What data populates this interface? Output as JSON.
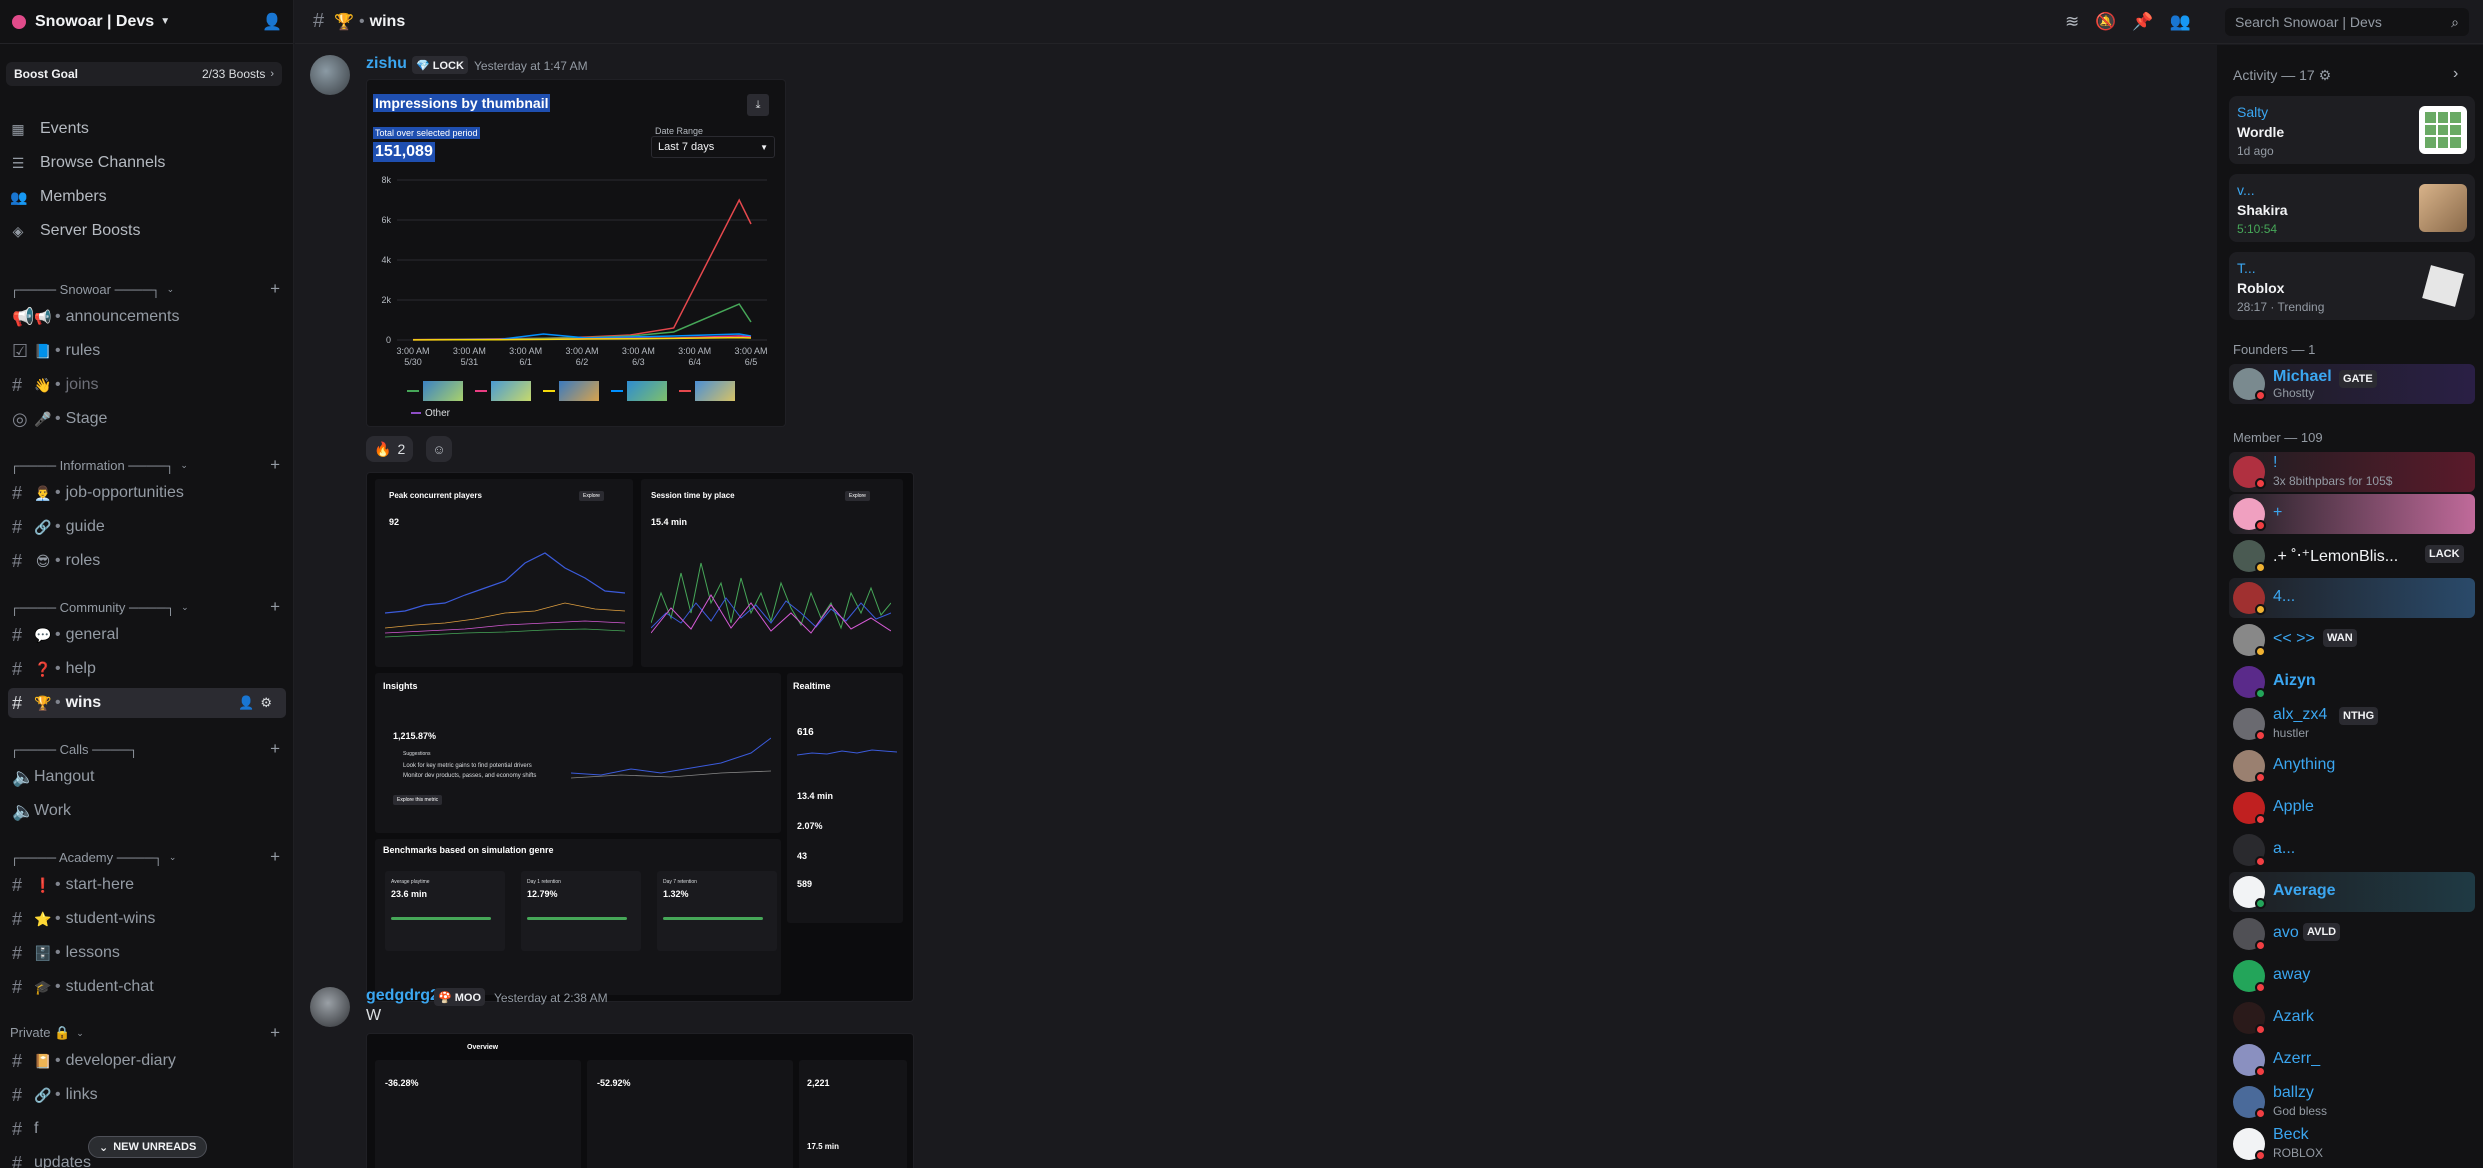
{
  "server": {
    "name": "Snowoar | Devs",
    "chevron": "⌄",
    "invite_icon": "person-add-icon"
  },
  "boost": {
    "label": "Boost Goal",
    "count": "2/33 Boosts"
  },
  "nav": [
    {
      "label": "Events",
      "icon": "calendar-icon"
    },
    {
      "label": "Browse Channels",
      "icon": "list-icon"
    },
    {
      "label": "Members",
      "icon": "people-icon"
    },
    {
      "label": "Server Boosts",
      "icon": "boost-icon"
    }
  ],
  "categories": [
    {
      "label": "┌──── Snowoar ────┐",
      "channels": [
        {
          "name": "announcements",
          "emoji": "📢"
        },
        {
          "name": "rules",
          "emoji": "📘"
        },
        {
          "name": "joins",
          "emoji": "👋",
          "muted": true
        },
        {
          "name": "Stage",
          "emoji": "🎤"
        }
      ]
    },
    {
      "label": "┌──── Information ────┐",
      "channels": [
        {
          "name": "job-opportunities",
          "emoji": "👨‍💼"
        },
        {
          "name": "guide",
          "emoji": "🔗"
        },
        {
          "name": "roles",
          "emoji": "😎"
        }
      ]
    },
    {
      "label": "┌──── Community ────┐",
      "channels": [
        {
          "name": "general",
          "emoji": "💬"
        },
        {
          "name": "help",
          "emoji": "❓"
        },
        {
          "name": "wins",
          "emoji": "🏆",
          "active": true
        }
      ]
    },
    {
      "label": "┌──── Calls ────┐",
      "channels": [
        {
          "name": "Hangout"
        },
        {
          "name": "Work"
        }
      ]
    },
    {
      "label": "┌──── Academy ────┐",
      "channels": [
        {
          "name": "start-here",
          "emoji": "❗"
        },
        {
          "name": "student-wins",
          "emoji": "⭐"
        },
        {
          "name": "lessons",
          "emoji": "🗄️"
        },
        {
          "name": "student-chat",
          "emoji": "🎓"
        }
      ]
    },
    {
      "label": "Private 🔒",
      "channels": [
        {
          "name": "developer-diary",
          "emoji": "📔"
        },
        {
          "name": "links",
          "emoji": "🔗"
        },
        {
          "name": "f"
        },
        {
          "name": "updates"
        }
      ]
    }
  ],
  "new_unreads": "NEW UNREADS",
  "channel_title": {
    "emoji": "🏆",
    "name": "wins"
  },
  "search": {
    "placeholder": "Search Snowoar | Devs"
  },
  "messages": [
    {
      "author": "zishu",
      "tag": "💎 LOCK",
      "time": "Yesterday at 1:47 AM"
    },
    {
      "author": "gedgdrg2",
      "tag": "🍄 MOO",
      "time": "Yesterday at 2:38 AM",
      "text": "W"
    }
  ],
  "impressions": {
    "title": "Impressions by thumbnail",
    "subtitle": "Total over selected period",
    "total": "151,089",
    "range_label": "Date Range",
    "range_value": "Last 7 days",
    "legend_other": "Other"
  },
  "chart_data": {
    "type": "line",
    "x": [
      "3:00 AM 5/30",
      "3:00 AM 5/31",
      "3:00 AM 6/1",
      "3:00 AM 6/2",
      "3:00 AM 6/3",
      "3:00 AM 6/4",
      "3:00 AM 6/5"
    ],
    "yticks": [
      "0",
      "2k",
      "4k",
      "6k",
      "8k"
    ],
    "ylim": [
      0,
      8000
    ],
    "series": [
      {
        "color": "#e5484d",
        "values": [
          20,
          40,
          60,
          90,
          150,
          250,
          600,
          7000,
          5800
        ]
      },
      {
        "color": "#46a758",
        "values": [
          10,
          20,
          40,
          80,
          120,
          200,
          400,
          1800,
          900
        ]
      },
      {
        "color": "#0090ff",
        "values": [
          10,
          20,
          30,
          300,
          100,
          150,
          200,
          300,
          200
        ]
      },
      {
        "color": "#e93d82",
        "values": [
          5,
          10,
          20,
          40,
          60,
          80,
          100,
          200,
          150
        ]
      },
      {
        "color": "#f5d90a",
        "values": [
          5,
          10,
          15,
          30,
          50,
          60,
          80,
          120,
          100
        ]
      }
    ]
  },
  "reactions": [
    {
      "emoji": "🔥",
      "count": "2"
    }
  ],
  "analytics": {
    "peak_title": "Peak concurrent players",
    "peak_value": "92",
    "session_title": "Session time by place",
    "session_value": "15.4 min",
    "explore": "Explore",
    "insights_title": "Insights",
    "insights_change": "1,215.87%",
    "suggestions": "Suggestions",
    "sugg1": "Look for key metric gains to find potential drivers",
    "sugg2": "Monitor dev products, passes, and economy shifts",
    "explore_metric": "Explore this metric",
    "realtime_title": "Realtime",
    "realtime_value": "616",
    "rt2": "13.4 min",
    "rt3": "2.07%",
    "rt4": "43",
    "rt5": "589",
    "bench_title": "Benchmarks based on simulation genre",
    "b1_label": "Average playtime",
    "b1_value": "23.6 min",
    "b2_label": "Day 1 retention",
    "b2_value": "12.79%",
    "b3_label": "Day 7 retention",
    "b3_value": "1.32%"
  },
  "analytics2": {
    "crumb": "Overview",
    "m1": "-36.28%",
    "m2": "-52.92%",
    "m3": "2,221",
    "m4": "17.5 min"
  },
  "activity": {
    "title": "Activity — 17",
    "items": [
      {
        "user": "Salty",
        "game": "Wordle",
        "meta": "1d ago",
        "thumb": "#3b8a3e"
      },
      {
        "user": "v...",
        "game": "Shakira",
        "meta": "5:10:54",
        "thumb": "#c9a27a"
      },
      {
        "user": "T...",
        "game": "Roblox",
        "meta": "28:17 · Trending",
        "thumb": "#e6e6e6"
      }
    ]
  },
  "founders": {
    "title": "Founders — 1",
    "members": [
      {
        "name": "Michael",
        "tag": "GATE",
        "status": "Ghostty"
      }
    ]
  },
  "members": {
    "title": "Member — 109",
    "list": [
      {
        "name": "!",
        "status": "3x 8bithpbars for 105$"
      },
      {
        "name": "+"
      },
      {
        "name": ".+ ˚‧⁺LemonBlis...",
        "tag": "LACK"
      },
      {
        "name": "4..."
      },
      {
        "name": "<< >>",
        "tag": "WAN"
      },
      {
        "name": "Aizyn"
      },
      {
        "name": "alx_zx4",
        "tag": "NTHG",
        "status": "hustler"
      },
      {
        "name": "Anything"
      },
      {
        "name": "Apple"
      },
      {
        "name": "a..."
      },
      {
        "name": "Average"
      },
      {
        "name": "avo",
        "tag": "AVLD"
      },
      {
        "name": "away"
      },
      {
        "name": "Azark"
      },
      {
        "name": "Azerr_"
      },
      {
        "name": "ballzy",
        "status": "God bless"
      },
      {
        "name": "Beck",
        "status": "ROBLOX"
      }
    ]
  }
}
